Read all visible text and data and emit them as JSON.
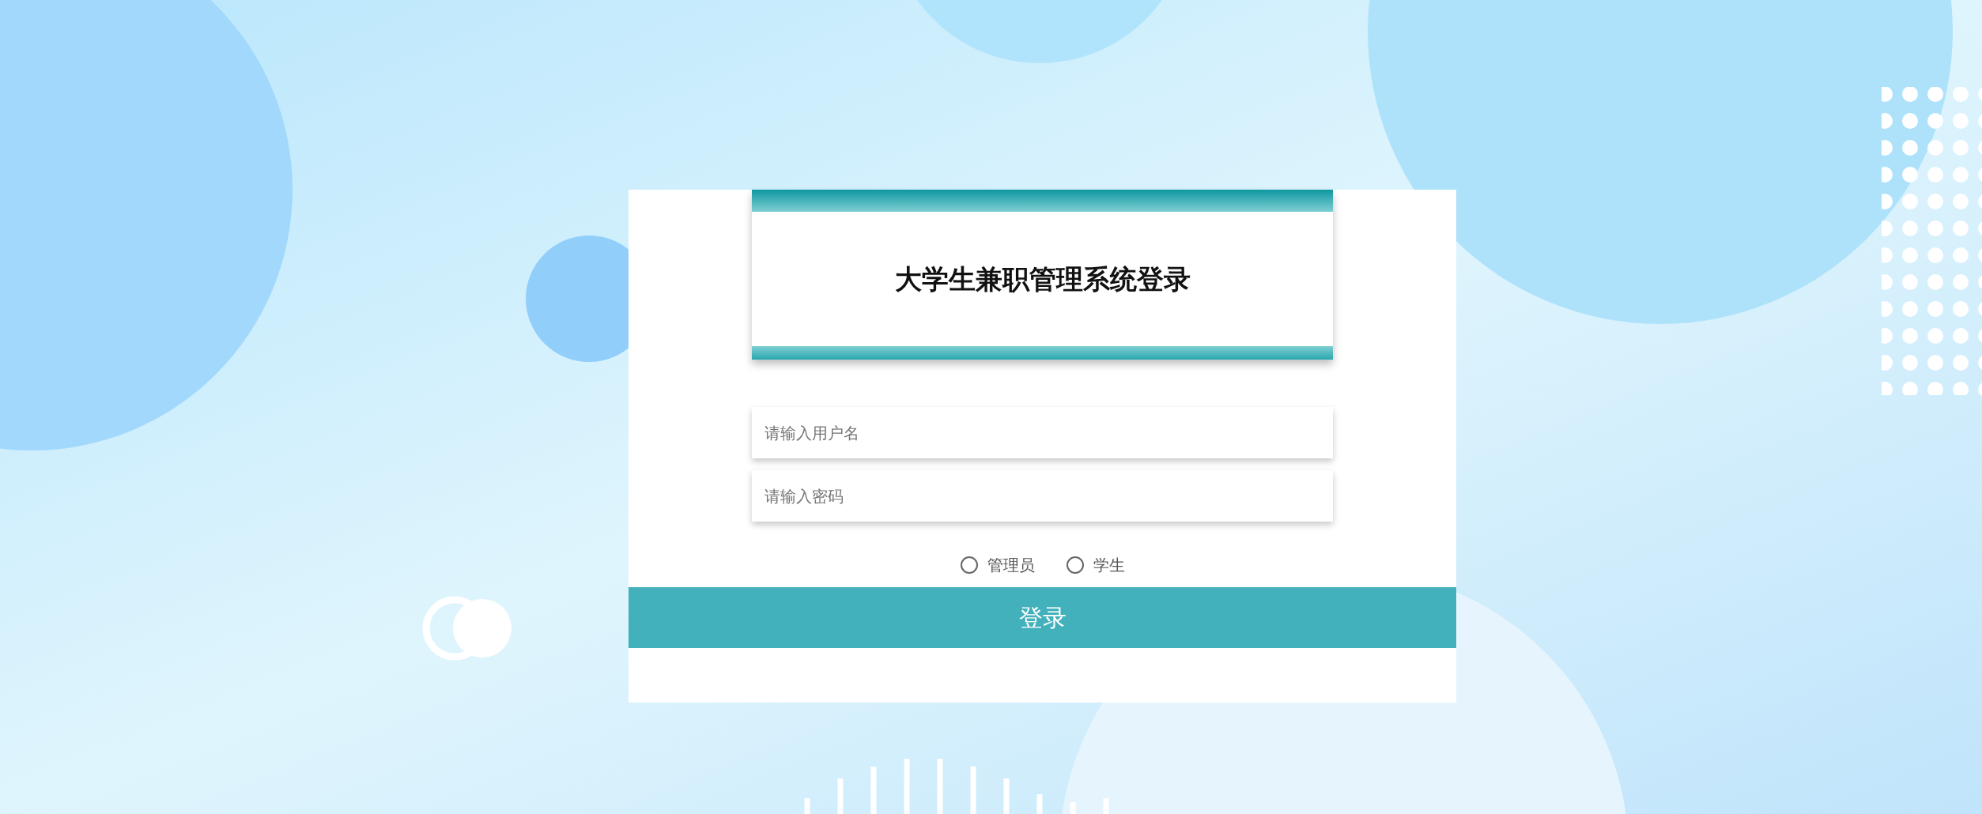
{
  "title": "大学生兼职管理系统登录",
  "username_field": {
    "placeholder": "请输入用户名"
  },
  "password_field": {
    "placeholder": "请输入密码"
  },
  "roles": [
    {
      "label": "管理员",
      "selected": false
    },
    {
      "label": "学生",
      "selected": false
    }
  ],
  "login_button": "登录"
}
